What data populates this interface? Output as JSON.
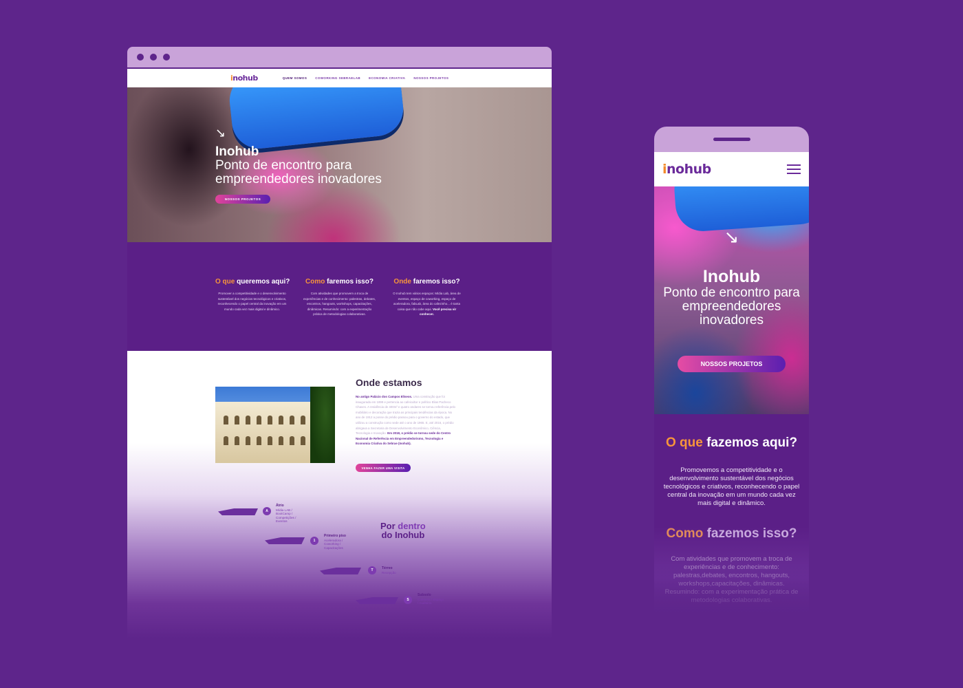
{
  "brand": {
    "logo_prefix": "i",
    "logo_text": "nohub",
    "bg": "#5e258b",
    "accent_orange": "#f7953b",
    "accent_pink": "#e0449a"
  },
  "desktop": {
    "nav": [
      {
        "label": "QUEM SOMOS",
        "active": true
      },
      {
        "label": "COWORKING SEBRAELAB",
        "active": false
      },
      {
        "label": "ECONOMIA CRIATIVA",
        "active": false
      },
      {
        "label": "NOSSOS PROJETOS",
        "active": false
      }
    ],
    "hero": {
      "arrow": "↘",
      "title": "Inohub",
      "subtitle": "Ponto de encontro para empreendedores inovadores",
      "button": "NOSSOS PROJETOS"
    },
    "columns": [
      {
        "h_accent": "O que",
        "h_rest": " queremos aqui?",
        "text": "Promover a competitividade e o desenvolvimento sustentável dos negócios tecnológicos e criativos, reconhecendo o papel central da inovação em um mundo cada vez mais digital e dinâmico.",
        "bold": ""
      },
      {
        "h_accent": "Como",
        "h_rest": " faremos isso?",
        "text": "Com atividades que promovem a troca de experiências e de conhecimento: palestras, debates, encontros, hangouts, workshops, capacitações, dinâmicas. Resumindo: com a experimentação prática de metodologias colaborativas.",
        "bold": ""
      },
      {
        "h_accent": "Onde",
        "h_rest": " faremos isso?",
        "text": "O Inohub tem vários espaços: Mídia Lab, área de eventos, espaço de coworking, espaço de aceleradora, fabLab, área do cafezinho... é tanta coisa que não cabe aqui. ",
        "bold": "Você precisa vir conhecer."
      }
    ],
    "onde": {
      "title": "Onde estamos",
      "bold_intro": "No antigo Palácio dos Campos Elíseos.",
      "text": " Uma construção que foi inaugurada em 1899 e pertencia ao cafeicultor e político Elias Pacheco Chaves. A residência de 400m² e quatro andares se tornou referência pelo mobiliário e decoração que trazia as principais tendências da época. No ano de 1912 a posse do prédio passou para o governo do estado, que utilizou a construção como sede até o ano de 1965. E, até 2016, o prédio abrigava a Secretaria de Desenvolvimento Econômico, Ciência, Tecnologia e Inovação. ",
      "bold_end": "Em 2018, o prédio se tornou sede do Centro Nacional de Referência em Empreendedorismo, Tecnologia e Economia Criativa do Sebrae (Inohub).",
      "button": "VENHA FAZER UMA VISITA"
    },
    "floors": [
      {
        "badge": "A",
        "name": "Átrio",
        "items": "Mídia LAB / BootCamp / Competições / Eventos"
      },
      {
        "badge": "1",
        "name": "Primeiro piso",
        "items": "Aceleradora / Coworking / Capacitações"
      },
      {
        "badge": "T",
        "name": "Térreo",
        "items": "Recepção"
      },
      {
        "badge": "S",
        "name": "Subsolo",
        "items": "Cafeteria / Espaço / Auditório"
      }
    ],
    "dentro": {
      "line1_a": "Por ",
      "line1_b": "dentro",
      "line2": "do Inohub"
    }
  },
  "mobile": {
    "hero": {
      "arrow": "↘",
      "title": "Inohub",
      "subtitle": "Ponto de encontro para empreendedores inovadores",
      "button": "NOSSOS PROJETOS"
    },
    "section1": {
      "h_accent": "O que",
      "h_rest": " fazemos aqui?",
      "text": "Promovemos a competitividade e o desenvolvimento sustentável dos negócios tecnológicos e criativos, reconhecendo o papel central da inovação em um mundo cada vez mais digital e dinâmico."
    },
    "section2": {
      "h_accent": "Como",
      "h_rest": " fazemos isso?",
      "text": "Com atividades que promovem a troca de experiências e de conhecimento: palestras,debates, encontros, hangouts, workshops,capacitações, dinâmicas. Resumindo: com a experimentação prática de metodologias colaborativas."
    }
  }
}
